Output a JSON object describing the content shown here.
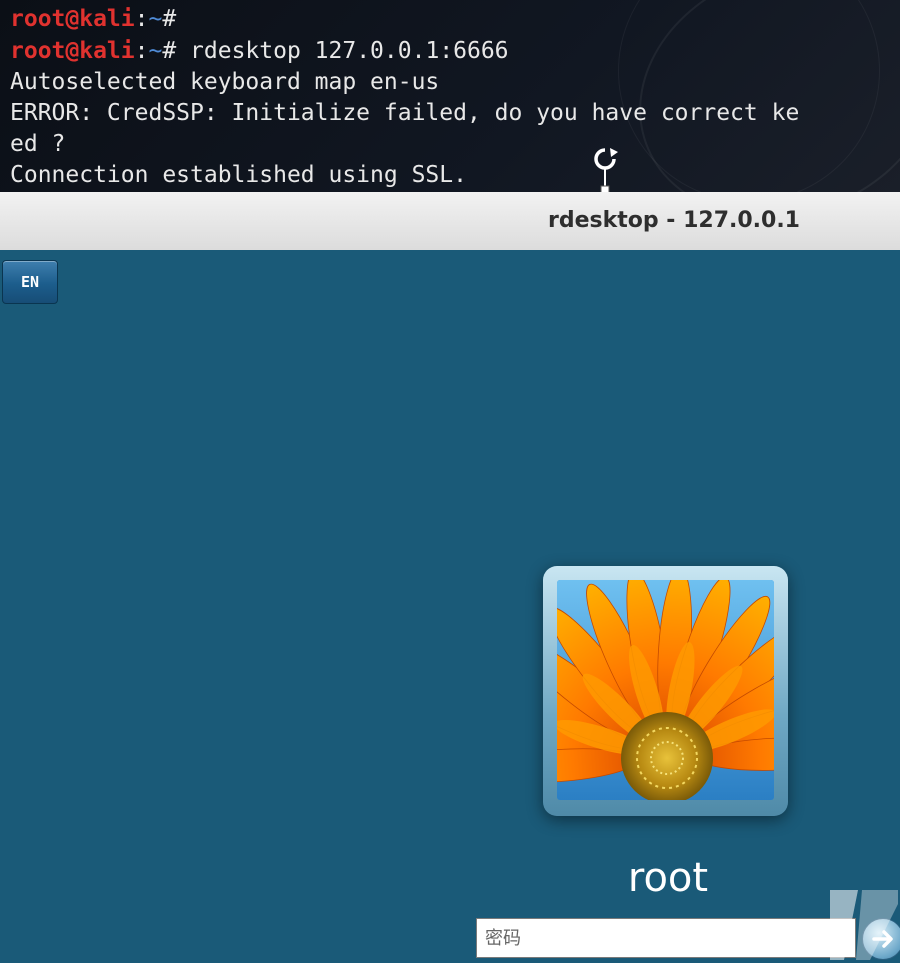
{
  "terminal": {
    "prompt_user": "root@kali",
    "prompt_colon": ":",
    "prompt_path": "~",
    "prompt_hash": "# ",
    "command": "rdesktop 127.0.0.1:6666",
    "output": [
      "Autoselected keyboard map en-us",
      "ERROR: CredSSP: Initialize failed, do you have correct ke",
      "ed ?",
      "Connection established using SSL."
    ],
    "background_color": "#0d1117",
    "user_color": "#e0322f",
    "path_color": "#4f8bd6"
  },
  "window": {
    "title": "rdesktop - 127.0.0.1"
  },
  "desktop": {
    "background_color": "#1a5a78",
    "language_indicator": "EN",
    "user_tile": {
      "username": "root",
      "avatar_icon": "orange-daisy-flower-picture"
    },
    "password": {
      "placeholder": "密码",
      "value": ""
    },
    "submit_icon": "arrow-right-icon"
  },
  "icons": {
    "cursor": "rotate-cursor-icon",
    "watermark": "watermark-logo-icon"
  }
}
